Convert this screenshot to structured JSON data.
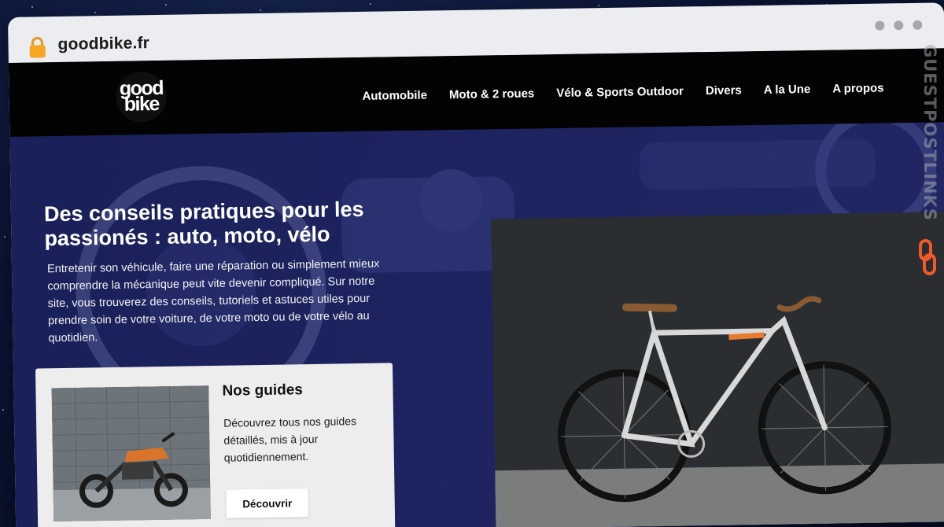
{
  "browser": {
    "url": "goodbike.fr",
    "lock_icon": "padlock-icon",
    "window_controls": [
      "dot",
      "dot",
      "dot"
    ]
  },
  "site": {
    "logo": {
      "line1": "good",
      "line2": "bike"
    },
    "nav": [
      {
        "label": "Automobile"
      },
      {
        "label": "Moto & 2 roues"
      },
      {
        "label": "Vélo & Sports Outdoor"
      },
      {
        "label": "Divers"
      },
      {
        "label": "A la Une"
      },
      {
        "label": "A propos"
      }
    ],
    "hero": {
      "title": "Des conseils pratiques pour les passionés : auto, moto, vélo",
      "text": "Entretenir son véhicule, faire une réparation ou simplement mieux comprendre la mécanique peut vite devenir compliqué. Sur notre site, vous trouverez des conseils, tutoriels et astuces utiles pour prendre soin de votre voiture, de votre moto ou de votre vélo au quotidien."
    },
    "guide_card": {
      "title": "Nos guides",
      "text": "Découvrez tous nos guides détaillés, mis à jour quotidiennement.",
      "button": "Découvrir"
    }
  },
  "watermark": {
    "text": "GUESTPOSTLINKS",
    "icon": "chain-link-icon"
  },
  "colors": {
    "navbar": "#030303",
    "hero_bg": "#1b2155",
    "card_bg": "#ededed",
    "watermark_accent": "#f05a28"
  }
}
